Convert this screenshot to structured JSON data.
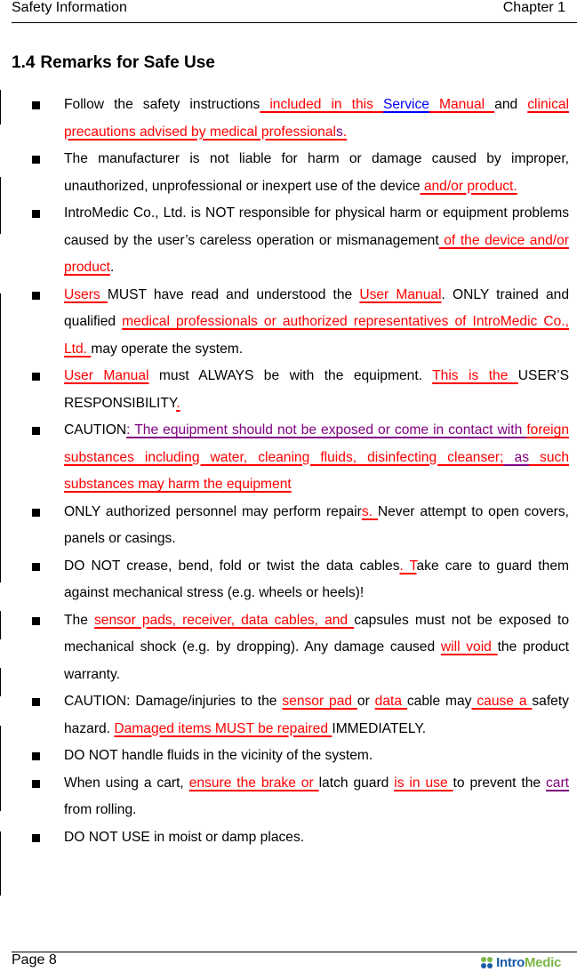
{
  "header": {
    "left": "Safety Information",
    "right": "Chapter 1"
  },
  "section": {
    "number": "1.4",
    "title": "Remarks for Safe Use"
  },
  "items": [
    {
      "segments": [
        {
          "t": "Follow the safety instructions",
          "s": ""
        },
        {
          "t": " included in this ",
          "s": "r"
        },
        {
          "t": "Service",
          "s": "b"
        },
        {
          "t": " Manual ",
          "s": "r"
        },
        {
          "t": "and ",
          "s": ""
        },
        {
          "t": "clinical precautions advised by medical professional",
          "s": "r"
        },
        {
          "t": "s",
          "s": "rp"
        },
        {
          "t": ".  ",
          "s": "r"
        }
      ]
    },
    {
      "segments": [
        {
          "t": "The manufacturer is not liable for harm or damage caused by improper, unauthorized, unprofessional or inexpert use of the device",
          "s": ""
        },
        {
          "t": " and/or product.",
          "s": "r"
        }
      ]
    },
    {
      "segments": [
        {
          "t": "IntroMedic Co., Ltd. is NOT responsible for physical harm or equipment problems caused by the user’s careless operation or mismanagement",
          "s": ""
        },
        {
          "t": " of the device and/or product",
          "s": "r"
        },
        {
          "t": ".",
          "s": ""
        }
      ]
    },
    {
      "segments": [
        {
          "t": "Users ",
          "s": "r"
        },
        {
          "t": "MUST have read and understood the ",
          "s": ""
        },
        {
          "t": "User Manual",
          "s": "r"
        },
        {
          "t": ". ONLY trained and qualified ",
          "s": ""
        },
        {
          "t": "medical professionals or authorized representatives of IntroMedic Co., Ltd. ",
          "s": "r"
        },
        {
          "t": "may operate the system.",
          "s": ""
        }
      ]
    },
    {
      "segments": [
        {
          "t": "User Manual",
          "s": "r"
        },
        {
          "t": " must ALWAYS be with the equipment. ",
          "s": ""
        },
        {
          "t": "This is the ",
          "s": "r"
        },
        {
          "t": "USER’S RESPONSIBILITY",
          "s": ""
        },
        {
          "t": ".",
          "s": "r"
        }
      ]
    },
    {
      "segments": [
        {
          "t": "CAUTION",
          "s": ""
        },
        {
          "t": ": The equipment should not be exposed or come in contact with ",
          "s": "p"
        },
        {
          "t": "foreign substances including water, cleaning fluids, disinfecting cleanser;",
          "s": "r"
        },
        {
          "t": " as",
          "s": "p"
        },
        {
          "t": " such substances may harm the equipment  ",
          "s": "r"
        }
      ]
    },
    {
      "segments": [
        {
          "t": "ONLY authorized personnel may perform repair",
          "s": ""
        },
        {
          "t": "s. ",
          "s": "r"
        },
        {
          "t": "Never attempt to open covers, panels or casings.",
          "s": ""
        }
      ]
    },
    {
      "segments": [
        {
          "t": "DO NOT crease, bend, fold or twist the data cables",
          "s": ""
        },
        {
          "t": ". T",
          "s": "r"
        },
        {
          "t": "ake care to guard them against mechanical stress (e.g. wheels or heels)!",
          "s": ""
        }
      ]
    },
    {
      "segments": [
        {
          "t": "The ",
          "s": ""
        },
        {
          "t": "sensor pads, receiver, data cables, and ",
          "s": "r"
        },
        {
          "t": "capsules must not be exposed to mechanical shock (e.g. by dropping). Any damage caused ",
          "s": ""
        },
        {
          "t": "will void ",
          "s": "r"
        },
        {
          "t": "the product",
          "s": ""
        },
        {
          "t": " ",
          "s": "ur"
        },
        {
          "t": "warranty.",
          "s": ""
        }
      ]
    },
    {
      "segments": [
        {
          "t": "CAUTION: Damage/injuries to the ",
          "s": ""
        },
        {
          "t": "sensor pad ",
          "s": "r"
        },
        {
          "t": "or ",
          "s": ""
        },
        {
          "t": "data ",
          "s": "r"
        },
        {
          "t": "cable may",
          "s": ""
        },
        {
          "t": " cause a ",
          "s": "r"
        },
        {
          "t": "safety hazard. ",
          "s": ""
        },
        {
          "t": "Damaged items MUST be repaired ",
          "s": "r"
        },
        {
          "t": "IMMEDIATELY.",
          "s": ""
        }
      ]
    },
    {
      "segments": [
        {
          "t": "DO NOT handle fluids in the vicinity of the system.",
          "s": ""
        }
      ]
    },
    {
      "segments": [
        {
          "t": "When using a cart, ",
          "s": ""
        },
        {
          "t": "ensure the brake or ",
          "s": "r"
        },
        {
          "t": "latch guard ",
          "s": ""
        },
        {
          "t": "is in use ",
          "s": "r"
        },
        {
          "t": "to prevent the ",
          "s": ""
        },
        {
          "t": "cart ",
          "s": "p"
        },
        {
          "t": "from rolling.",
          "s": ""
        }
      ]
    },
    {
      "segments": [
        {
          "t": "DO NOT USE in moist or damp places.",
          "s": ""
        }
      ]
    }
  ],
  "footer": {
    "page": "Page 8",
    "logo": {
      "part1": "Intro",
      "part2": "Medic",
      "color1": "#1a5aa8",
      "color2": "#7ab648"
    }
  },
  "colors": {
    "revision_red": "#ff0000",
    "revision_blue": "#0000ff",
    "revision_purple": "#800080"
  }
}
